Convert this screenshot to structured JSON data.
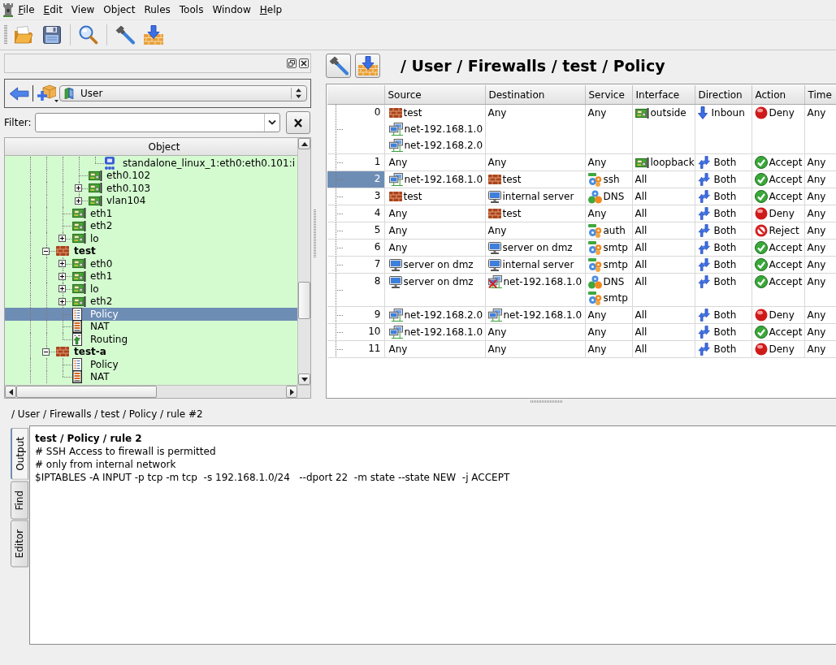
{
  "menu": [
    {
      "label": "File",
      "mnemonic": true
    },
    {
      "label": "Edit",
      "mnemonic": true
    },
    {
      "label": "View",
      "mnemonic": false
    },
    {
      "label": "Object",
      "mnemonic": false
    },
    {
      "label": "Rules",
      "mnemonic": false
    },
    {
      "label": "Tools",
      "mnemonic": false
    },
    {
      "label": "Window",
      "mnemonic": false
    },
    {
      "label": "Help",
      "mnemonic": true
    }
  ],
  "library": {
    "value": "User"
  },
  "filter": {
    "label": "Filter:"
  },
  "tree": {
    "header": "Object",
    "items": [
      {
        "children": [
          {
            "children": [
              {
                "children": [
                  {
                    "children": [
                      {
                        "children": [
                          {
                            "label": "standalone_linux_1:eth0:eth0.101:i",
                            "kind": "address",
                            "selected": false
                          }
                        ]
                      },
                      {
                        "label": "eth0.102",
                        "kind": "interface",
                        "selected": false
                      },
                      {
                        "label": "eth0.103",
                        "kind": "interface",
                        "expanded": false,
                        "selected": false
                      },
                      {
                        "label": "vlan104",
                        "kind": "interface",
                        "expanded": false,
                        "selected": false
                      }
                    ]
                  },
                  {
                    "label": "eth1",
                    "kind": "interface",
                    "selected": false
                  },
                  {
                    "label": "eth2",
                    "kind": "interface",
                    "selected": false
                  },
                  {
                    "label": "lo",
                    "kind": "interface",
                    "expanded": false,
                    "selected": false
                  }
                ]
              },
              {
                "label": "test",
                "kind": "firewall",
                "expanded": true,
                "selected": false,
                "children": [
                  {
                    "label": "eth0",
                    "kind": "interface",
                    "expanded": false,
                    "selected": false
                  },
                  {
                    "label": "eth1",
                    "kind": "interface",
                    "expanded": false,
                    "selected": false
                  },
                  {
                    "label": "lo",
                    "kind": "interface",
                    "expanded": false,
                    "selected": false
                  },
                  {
                    "label": "eth2",
                    "kind": "interface",
                    "expanded": false,
                    "selected": false
                  },
                  {
                    "label": "Policy",
                    "kind": "policy",
                    "selected": true
                  },
                  {
                    "label": "NAT",
                    "kind": "nat",
                    "selected": false
                  },
                  {
                    "label": "Routing",
                    "kind": "routing",
                    "selected": false
                  }
                ]
              },
              {
                "label": "test-a",
                "kind": "firewall",
                "expanded": true,
                "selected": false,
                "children": [
                  {
                    "label": "Policy",
                    "kind": "policy",
                    "selected": false
                  },
                  {
                    "label": "NAT",
                    "kind": "nat",
                    "selected": false
                  }
                ]
              }
            ]
          }
        ]
      }
    ]
  },
  "editor_title": "/ User / Firewalls / test / Policy",
  "rules_table": {
    "columns": [
      "Source",
      "Destination",
      "Service",
      "Interface",
      "Direction",
      "Action",
      "Time"
    ],
    "rows": [
      {
        "number": "0",
        "selected": false,
        "source": [
          {
            "text": "test",
            "kind": "firewall"
          },
          {
            "text": "net-192.168.1.0",
            "kind": "network"
          },
          {
            "text": "net-192.168.2.0",
            "kind": "network"
          }
        ],
        "destination": [
          {
            "text": "Any"
          }
        ],
        "service": [
          {
            "text": "Any"
          }
        ],
        "interface": [
          {
            "text": "outside",
            "kind": "interface"
          }
        ],
        "direction": {
          "text": "Inboun",
          "kind": "inbound"
        },
        "action": {
          "text": "Deny",
          "kind": "deny"
        },
        "time": "Any"
      },
      {
        "number": "1",
        "selected": false,
        "source": [
          {
            "text": "Any"
          }
        ],
        "destination": [
          {
            "text": "Any"
          }
        ],
        "service": [
          {
            "text": "Any"
          }
        ],
        "interface": [
          {
            "text": "loopback",
            "kind": "interface"
          }
        ],
        "direction": {
          "text": "Both",
          "kind": "both"
        },
        "action": {
          "text": "Accept",
          "kind": "accept"
        },
        "time": "Any"
      },
      {
        "number": "2",
        "selected": true,
        "source": [
          {
            "text": "net-192.168.1.0",
            "kind": "network"
          }
        ],
        "destination": [
          {
            "text": "test",
            "kind": "firewall",
            "negated": false
          }
        ],
        "service": [
          {
            "text": "ssh",
            "kind": "tcp"
          }
        ],
        "interface": [
          {
            "text": "All"
          }
        ],
        "direction": {
          "text": "Both",
          "kind": "both"
        },
        "action": {
          "text": "Accept",
          "kind": "accept"
        },
        "time": "Any"
      },
      {
        "number": "3",
        "selected": false,
        "source": [
          {
            "text": "test",
            "kind": "firewall"
          }
        ],
        "destination": [
          {
            "text": "internal server",
            "kind": "host",
            "negated": false
          }
        ],
        "service": [
          {
            "text": "DNS",
            "kind": "group"
          }
        ],
        "interface": [
          {
            "text": "All"
          }
        ],
        "direction": {
          "text": "Both",
          "kind": "both"
        },
        "action": {
          "text": "Accept",
          "kind": "accept"
        },
        "time": "Any"
      },
      {
        "number": "4",
        "selected": false,
        "source": [
          {
            "text": "Any"
          }
        ],
        "destination": [
          {
            "text": "test",
            "kind": "firewall",
            "negated": false
          }
        ],
        "service": [
          {
            "text": "Any"
          }
        ],
        "interface": [
          {
            "text": "All"
          }
        ],
        "direction": {
          "text": "Both",
          "kind": "both"
        },
        "action": {
          "text": "Deny",
          "kind": "deny"
        },
        "time": "Any"
      },
      {
        "number": "5",
        "selected": false,
        "source": [
          {
            "text": "Any"
          }
        ],
        "destination": [
          {
            "text": "Any"
          }
        ],
        "service": [
          {
            "text": "auth",
            "kind": "tcp"
          }
        ],
        "interface": [
          {
            "text": "All"
          }
        ],
        "direction": {
          "text": "Both",
          "kind": "both"
        },
        "action": {
          "text": "Reject",
          "kind": "reject"
        },
        "time": "Any"
      },
      {
        "number": "6",
        "selected": false,
        "source": [
          {
            "text": "Any"
          }
        ],
        "destination": [
          {
            "text": "server on dmz",
            "kind": "host",
            "negated": false
          }
        ],
        "service": [
          {
            "text": "smtp",
            "kind": "tcp"
          }
        ],
        "interface": [
          {
            "text": "All"
          }
        ],
        "direction": {
          "text": "Both",
          "kind": "both"
        },
        "action": {
          "text": "Accept",
          "kind": "accept"
        },
        "time": "Any"
      },
      {
        "number": "7",
        "selected": false,
        "source": [
          {
            "text": "server on dmz",
            "kind": "host"
          }
        ],
        "destination": [
          {
            "text": "internal server",
            "kind": "host",
            "negated": false
          }
        ],
        "service": [
          {
            "text": "smtp",
            "kind": "tcp"
          }
        ],
        "interface": [
          {
            "text": "All"
          }
        ],
        "direction": {
          "text": "Both",
          "kind": "both"
        },
        "action": {
          "text": "Accept",
          "kind": "accept"
        },
        "time": "Any"
      },
      {
        "number": "8",
        "selected": false,
        "source": [
          {
            "text": "server on dmz",
            "kind": "host"
          }
        ],
        "destination": [
          {
            "text": "net-192.168.1.0",
            "kind": "network",
            "negated": true
          }
        ],
        "service": [
          {
            "text": "DNS",
            "kind": "group"
          },
          {
            "text": "smtp",
            "kind": "tcp"
          }
        ],
        "interface": [
          {
            "text": "All"
          }
        ],
        "direction": {
          "text": "Both",
          "kind": "both"
        },
        "action": {
          "text": "Accept",
          "kind": "accept"
        },
        "time": "Any"
      },
      {
        "number": "9",
        "selected": false,
        "source": [
          {
            "text": "net-192.168.2.0",
            "kind": "network"
          }
        ],
        "destination": [
          {
            "text": "net-192.168.1.0",
            "kind": "network",
            "negated": false
          }
        ],
        "service": [
          {
            "text": "Any"
          }
        ],
        "interface": [
          {
            "text": "All"
          }
        ],
        "direction": {
          "text": "Both",
          "kind": "both"
        },
        "action": {
          "text": "Deny",
          "kind": "deny"
        },
        "time": "Any"
      },
      {
        "number": "10",
        "selected": false,
        "source": [
          {
            "text": "net-192.168.1.0",
            "kind": "network"
          }
        ],
        "destination": [
          {
            "text": "Any"
          }
        ],
        "service": [
          {
            "text": "Any"
          }
        ],
        "interface": [
          {
            "text": "All"
          }
        ],
        "direction": {
          "text": "Both",
          "kind": "both"
        },
        "action": {
          "text": "Accept",
          "kind": "accept"
        },
        "time": "Any"
      },
      {
        "number": "11",
        "selected": false,
        "source": [
          {
            "text": "Any"
          }
        ],
        "destination": [
          {
            "text": "Any"
          }
        ],
        "service": [
          {
            "text": "Any"
          }
        ],
        "interface": [
          {
            "text": "All"
          }
        ],
        "direction": {
          "text": "Both",
          "kind": "both"
        },
        "action": {
          "text": "Deny",
          "kind": "deny"
        },
        "time": "Any"
      }
    ]
  },
  "status_path": "/ User / Firewalls / test / Policy / rule #2",
  "output_tabs": [
    {
      "label": "Output",
      "selected": true
    },
    {
      "label": "Find",
      "selected": false
    },
    {
      "label": "Editor",
      "selected": false
    }
  ],
  "output": {
    "heading": "test / Policy / rule 2",
    "lines": [
      "# SSH Access to firewall is permitted",
      "# only from internal network",
      "$IPTABLES -A INPUT -p tcp -m tcp  -s 192.168.1.0/24   --dport 22  -m state --state NEW  -j ACCEPT"
    ]
  }
}
